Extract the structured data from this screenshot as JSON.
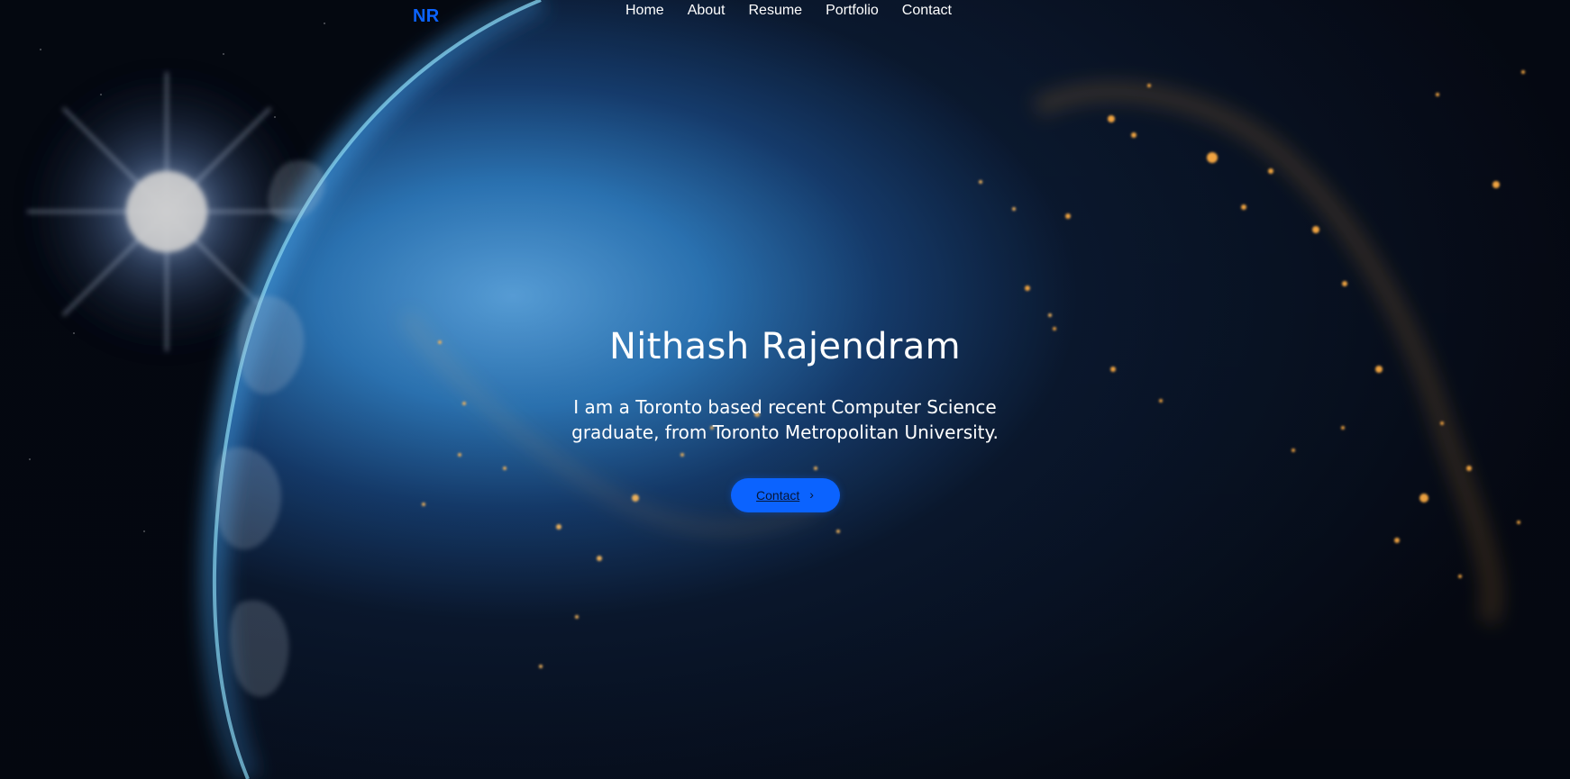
{
  "brand": {
    "label": "NR",
    "color": "#0b63ff"
  },
  "nav": {
    "items": [
      {
        "label": "Home"
      },
      {
        "label": "About"
      },
      {
        "label": "Resume"
      },
      {
        "label": "Portfolio"
      },
      {
        "label": "Contact"
      }
    ]
  },
  "hero": {
    "name": "Nithash Rajendram",
    "description": "I am a Toronto based recent Computer Science graduate, from Toronto Metropolitan University.",
    "cta": {
      "label": "Contact",
      "icon": "chevron-right-icon",
      "icon_glyph": "›",
      "color": "#0b63ff"
    }
  },
  "background": {
    "subject": "earth-at-night-from-space",
    "accent_colors": [
      "#0b63ff",
      "#ffb347",
      "#1d5fa7"
    ]
  }
}
